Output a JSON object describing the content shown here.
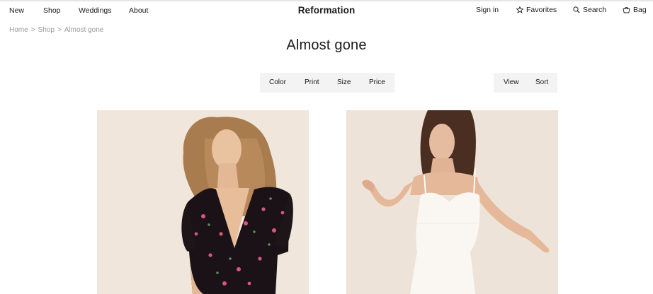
{
  "header": {
    "nav_left": [
      "New",
      "Shop",
      "Weddings",
      "About"
    ],
    "brand": "Reformation",
    "sign_in": "Sign in",
    "favorites": "Favorites",
    "search": "Search",
    "bag": "Bag"
  },
  "breadcrumb": [
    "Home",
    "Shop",
    "Almost gone"
  ],
  "page_title": "Almost gone",
  "filters": [
    "Color",
    "Print",
    "Size",
    "Price"
  ],
  "view_controls": [
    "View",
    "Sort"
  ],
  "products": [
    {
      "image": "model in black floral wrap dress"
    },
    {
      "image": "model in white slip dress"
    }
  ],
  "colors": {
    "background": "#ffffff",
    "filter_bg": "#f3f3f3",
    "photo_bg": "#efe5da",
    "muted_text": "#999999"
  }
}
